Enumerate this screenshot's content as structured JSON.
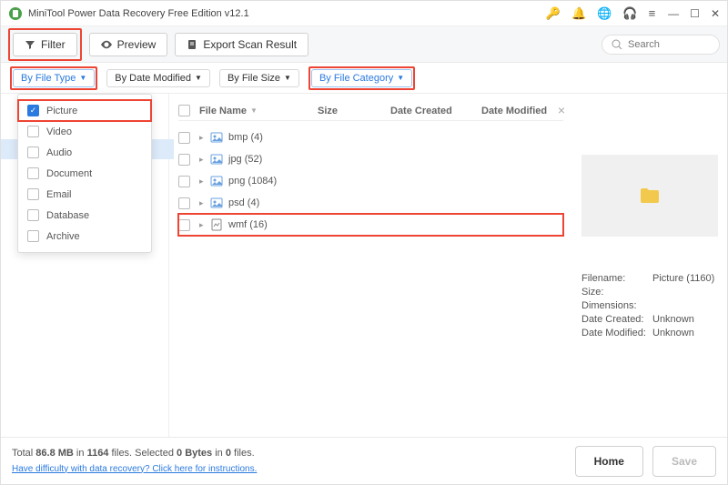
{
  "title": "MiniTool Power Data Recovery Free Edition v12.1",
  "toolbar": {
    "filter": "Filter",
    "preview": "Preview",
    "export": "Export Scan Result"
  },
  "search_placeholder": "Search",
  "filters": {
    "file_type": "By File Type",
    "date_modified": "By Date Modified",
    "file_size": "By File Size",
    "file_category": "By File Category"
  },
  "dropdown": {
    "options": [
      {
        "label": "Picture",
        "checked": true,
        "hl": true
      },
      {
        "label": "Video",
        "checked": false
      },
      {
        "label": "Audio",
        "checked": false
      },
      {
        "label": "Document",
        "checked": false
      },
      {
        "label": "Email",
        "checked": false
      },
      {
        "label": "Database",
        "checked": false
      },
      {
        "label": "Archive",
        "checked": false
      }
    ]
  },
  "columns": {
    "name": "File Name",
    "size": "Size",
    "date_created": "Date Created",
    "date_modified": "Date Modified"
  },
  "rows": [
    {
      "name": "bmp (4)",
      "icon": "image",
      "hl": false
    },
    {
      "name": "jpg (52)",
      "icon": "image",
      "hl": false
    },
    {
      "name": "png (1084)",
      "icon": "image",
      "hl": false
    },
    {
      "name": "psd (4)",
      "icon": "image",
      "hl": false
    },
    {
      "name": "wmf (16)",
      "icon": "wmf",
      "hl": true
    }
  ],
  "detail": {
    "filename_k": "Filename:",
    "filename_v": "Picture (1160)",
    "size_k": "Size:",
    "size_v": "",
    "dim_k": "Dimensions:",
    "dim_v": "",
    "dc_k": "Date Created:",
    "dc_v": "Unknown",
    "dm_k": "Date Modified:",
    "dm_v": "Unknown"
  },
  "footer": {
    "total_a": "Total ",
    "total_b": "86.8 MB",
    "total_c": " in ",
    "total_d": "1164",
    "total_e": " files.   Selected ",
    "total_f": "0 Bytes",
    "total_g": " in ",
    "total_h": "0",
    "total_i": " files.",
    "help": "Have difficulty with data recovery? Click here for instructions.",
    "home": "Home",
    "save": "Save"
  }
}
